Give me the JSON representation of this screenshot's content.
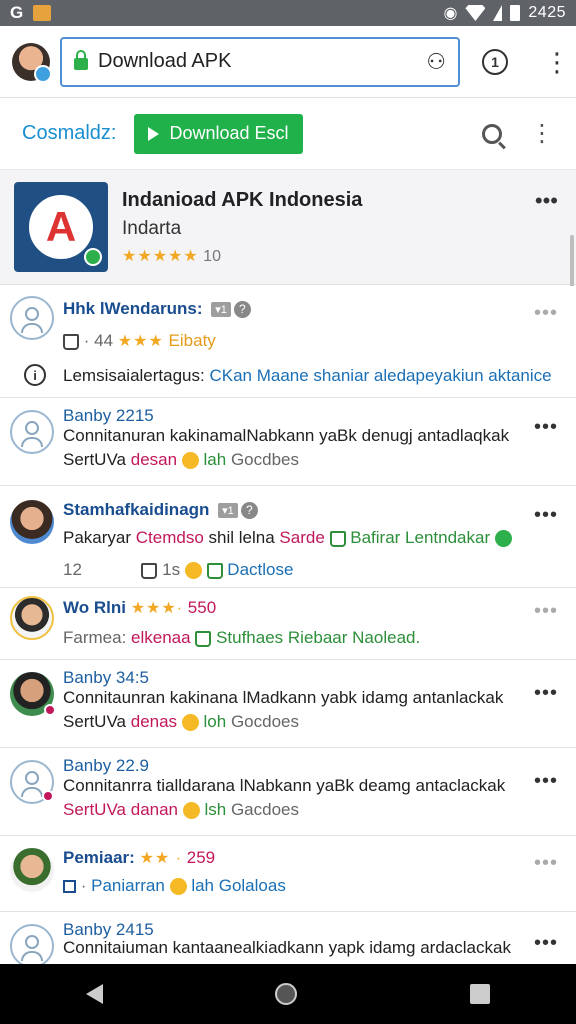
{
  "status": {
    "left_icon": "G",
    "time": "2425"
  },
  "browser": {
    "url_text": "Download APK",
    "tab_count": "1"
  },
  "site": {
    "brand": "Cosmaldz:",
    "download_button": "Download Escl"
  },
  "app": {
    "title": "Indanioad APK Indonesia",
    "developer": "Indarta",
    "stars": "★★★★★",
    "rating": "10"
  },
  "reviews": [
    {
      "name": "Hhk lWendaruns:",
      "meta_num": "44",
      "meta_stars": "★★★",
      "meta_word": "Eibaty",
      "info_label": "Lemsisaialertagus:",
      "info_text": "CKan Maane shaniar aledapeyakiun aktanice"
    },
    {
      "name": "Banby 2215",
      "body": "Connitanuran kakinamalNabkann yaBk denugj antadlaqkak",
      "line3_a": "SertUVa",
      "line3_b": "desan",
      "line3_c": "lah",
      "line3_d": "Gocdbes"
    },
    {
      "name": "Stamhafkaidinagn",
      "body_a": "Pakaryar",
      "body_b": "Ctemdso",
      "body_c": "shil lelna",
      "body_d": "Sarde",
      "body_e": "Bafirar Lentndakar",
      "foot_a": "12",
      "foot_b": "1s",
      "foot_c": "Dactlose"
    },
    {
      "name": "Wo Rlni",
      "stars": "★★★·",
      "score": "550",
      "body_a": "Farmea:",
      "body_b": "elkenaa",
      "body_c": "Stufhaes Riebaar Naolead."
    },
    {
      "name": "Banby 34:5",
      "body": "Connitaunran kakinana lMadkann yabk idamg antanlackak",
      "line3_a": "SertUVa",
      "line3_b": "denas",
      "line3_c": "loh",
      "line3_d": "Gocdoes"
    },
    {
      "name": "Banby 22.9",
      "body": "Connitanrra tialldarana lNabkann yaBk deamg antaclackak",
      "line3_a": "SertUVa",
      "line3_b": "danan",
      "line3_c": "lsh",
      "line3_d": "Gacdoes"
    },
    {
      "name": "Pemiaar:",
      "stars": "★★ ·",
      "score": "259",
      "body_a": "Paniarran",
      "body_b": "lah Golaloas"
    },
    {
      "name": "Banby 2415",
      "body": "Connitaiuman kantaanealkiadkann yapk idamg ardaclackak"
    }
  ]
}
